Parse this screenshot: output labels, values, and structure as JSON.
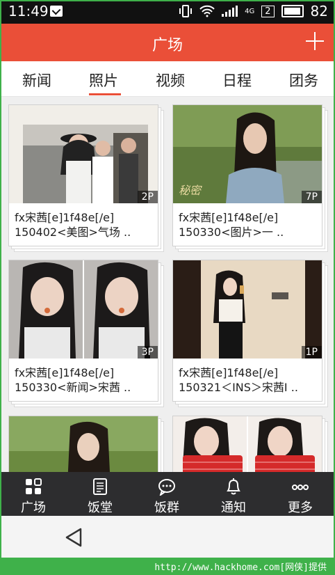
{
  "status": {
    "time": "11:49",
    "network": "4G",
    "sim": "2",
    "battery": "82"
  },
  "appbar": {
    "title": "广场"
  },
  "tabs": [
    {
      "label": "新闻"
    },
    {
      "label": "照片"
    },
    {
      "label": "视频"
    },
    {
      "label": "日程"
    },
    {
      "label": "团务"
    }
  ],
  "active_tab": "照片",
  "cards": [
    {
      "badge": "2P",
      "line1": "fx宋茜[e]1f48e[/e]",
      "line2": "150402<美图>气场 .."
    },
    {
      "badge": "7P",
      "line1": "fx宋茜[e]1f48e[/e]",
      "line2": "150330<图片>一 .."
    },
    {
      "badge": "3P",
      "line1": "fx宋茜[e]1f48e[/e]",
      "line2": "150330<新闻>宋茜 .."
    },
    {
      "badge": "1P",
      "line1": "fx宋茜[e]1f48e[/e]",
      "line2": "150321＜INS＞宋茜I .."
    },
    {
      "badge": "",
      "line1": "",
      "line2": ""
    },
    {
      "badge": "",
      "line1": "",
      "line2": ""
    }
  ],
  "bottomnav": [
    {
      "label": "广场",
      "icon": "grid-icon"
    },
    {
      "label": "饭堂",
      "icon": "document-icon"
    },
    {
      "label": "饭群",
      "icon": "chat-bubble-icon"
    },
    {
      "label": "通知",
      "icon": "bell-icon"
    },
    {
      "label": "更多",
      "icon": "more-icon"
    }
  ],
  "footer": {
    "watermark": "http://www.hackhome.com[网侠]提供"
  }
}
